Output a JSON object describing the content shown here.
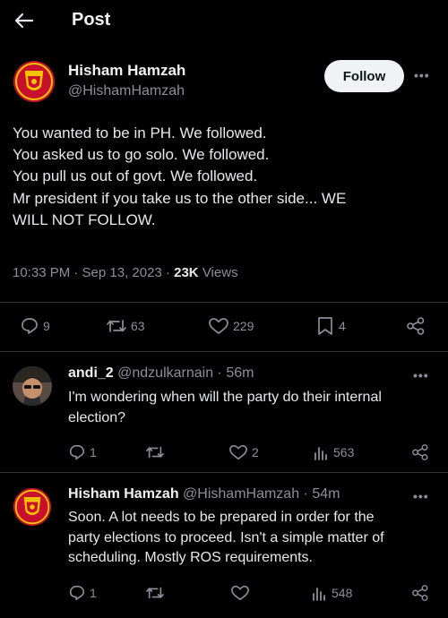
{
  "header": {
    "title": "Post"
  },
  "post": {
    "author": {
      "name": "Hisham Hamzah",
      "handle": "@HishamHamzah"
    },
    "follow_label": "Follow",
    "lines": [
      "You wanted to be in PH. We followed.",
      "You asked us to go solo. We followed.",
      "You pull us out of govt. We followed.",
      "Mr president if you take us to the other side... WE",
      "WILL NOT FOLLOW."
    ],
    "time": "10:33 PM · Sep 13, 2023 · ",
    "views_count": "23K",
    "views_label": " Views",
    "actions": {
      "replies": "9",
      "reposts": "63",
      "likes": "229",
      "bookmarks": "4"
    }
  },
  "replies": [
    {
      "name": "andi_2",
      "handle": "@ndzulkarnain · 56m",
      "lines": [
        "I'm wondering when will the party do their internal",
        "election?"
      ],
      "actions": {
        "replies": "1",
        "reposts": "",
        "likes": "2",
        "views": "563"
      }
    },
    {
      "name": "Hisham Hamzah",
      "handle": "@HishamHamzah · 54m",
      "lines": [
        "Soon. A lot needs to be prepared in order for the",
        "party elections to proceed. Isn't a simple matter of",
        "scheduling. Mostly ROS requirements."
      ],
      "actions": {
        "replies": "1",
        "reposts": "",
        "likes": "",
        "views": "548"
      }
    }
  ],
  "icons": {
    "back": "back-arrow-icon",
    "more": "more-options-icon",
    "reply": "reply-icon",
    "repost": "repost-icon",
    "like": "like-icon",
    "bookmark": "bookmark-icon",
    "share": "share-icon",
    "views": "views-icon"
  },
  "colors": {
    "background": "#000000",
    "text": "#e7e9ea",
    "muted": "#8b9096",
    "follow_bg": "#eff3f4",
    "badge_red": "#c8102e",
    "badge_gold": "#f5c400"
  }
}
